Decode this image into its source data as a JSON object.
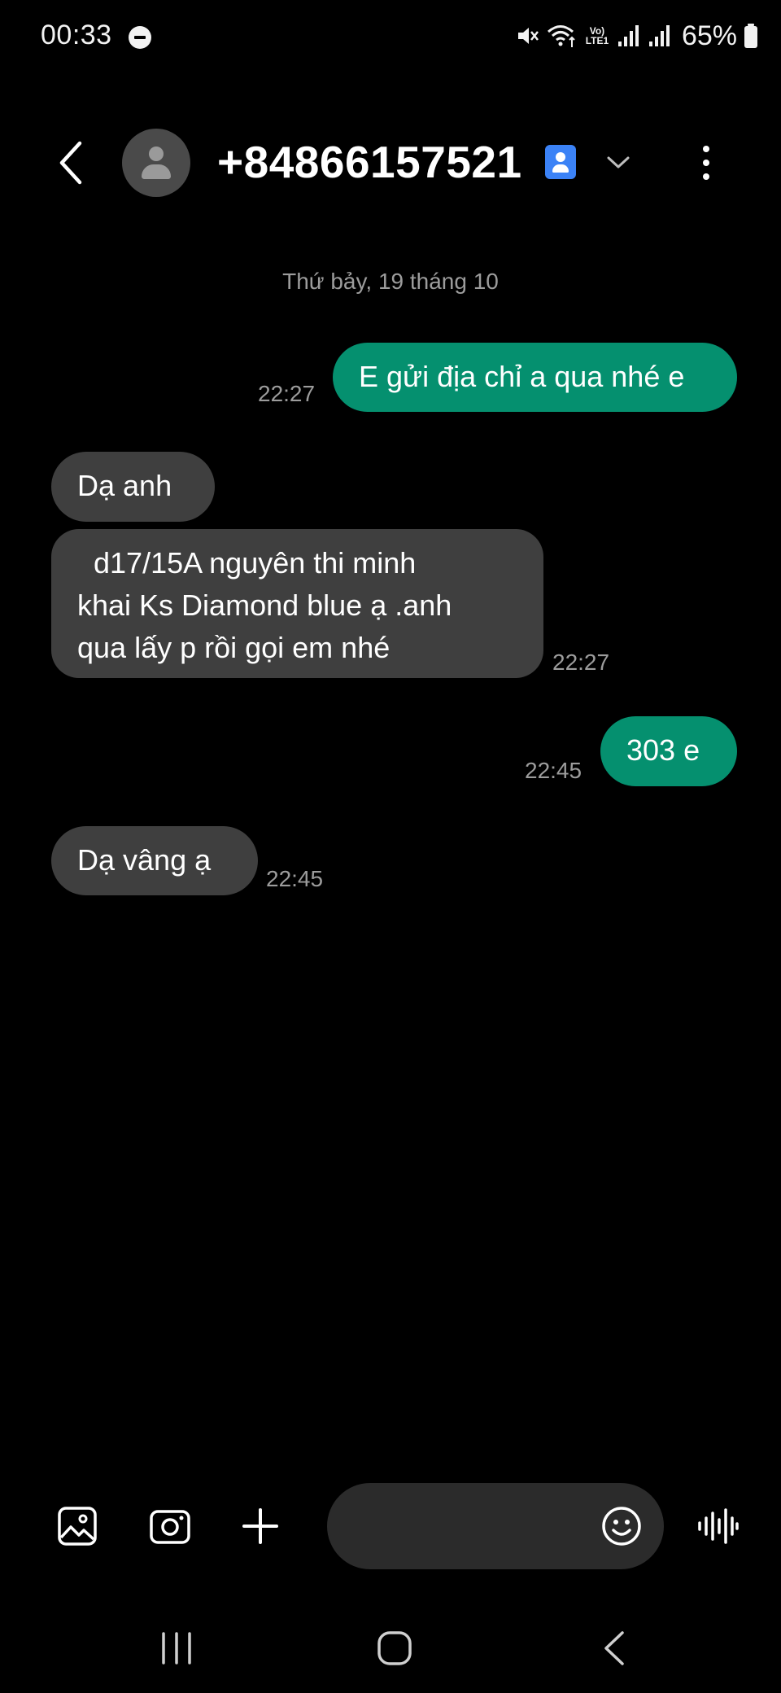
{
  "status_bar": {
    "time": "00:33",
    "network_label": "Vo) LTE1",
    "battery": "65%",
    "icons": [
      "do-not-disturb-icon",
      "mute-icon",
      "wifi-icon",
      "volte-icon",
      "signal-icon",
      "signal-icon",
      "battery-icon"
    ]
  },
  "header": {
    "contact": "+84866157521",
    "icons": [
      "back-arrow-icon",
      "avatar-icon",
      "contact-card-icon",
      "chevron-down-icon",
      "more-vert-icon"
    ]
  },
  "conversation": {
    "date_separator": "Thứ bảy, 19 tháng 10",
    "messages": [
      {
        "direction": "outgoing",
        "text": "E gửi địa chỉ a qua nhé e",
        "time": "22:27"
      },
      {
        "direction": "incoming",
        "text": "Dạ anh",
        "time": ""
      },
      {
        "direction": "incoming",
        "lines": [
          "  d17/15A nguyên thi minh",
          "khai Ks Diamond blue ạ .anh",
          "qua lấy p rồi gọi em nhé"
        ],
        "time": "22:27"
      },
      {
        "direction": "outgoing",
        "text": "303 e",
        "time": "22:45"
      },
      {
        "direction": "incoming",
        "text": "Dạ vâng ạ",
        "time": "22:45"
      }
    ]
  },
  "composer": {
    "placeholder": "",
    "icons": [
      "gallery-icon",
      "camera-icon",
      "plus-icon",
      "emoji-icon",
      "voice-icon"
    ]
  },
  "navbar": {
    "icons": [
      "recents-icon",
      "home-icon",
      "back-icon"
    ]
  },
  "colors": {
    "background": "#000000",
    "outgoing_bubble": "#05906f",
    "incoming_bubble": "#3f3f3f",
    "timestamp": "#9c9c9c",
    "contact_card": "#3b82f6"
  }
}
